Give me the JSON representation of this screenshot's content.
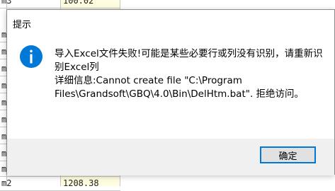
{
  "background_sheet": {
    "top_row": {
      "col_a": "m3",
      "col_b": "100.02"
    },
    "left_cells": [
      "m",
      "m",
      "m",
      "m",
      "m",
      "m",
      "m",
      "m",
      "m"
    ],
    "bottom_row": {
      "col_a": "m2",
      "col_b": "1208.38"
    }
  },
  "dialog": {
    "title": "提示",
    "icon": "info-icon",
    "accent_color": "#0078d7",
    "message_line1": "导入Excel文件失败!可能是某些必要行或列没有识别，请重新识别Excel列",
    "message_line2": "详细信息:Cannot create file \"C:\\Program Files\\Grandsoft\\GBQ\\4.0\\Bin\\DelHtm.bat\". 拒绝访问。",
    "ok_label": "确定"
  }
}
